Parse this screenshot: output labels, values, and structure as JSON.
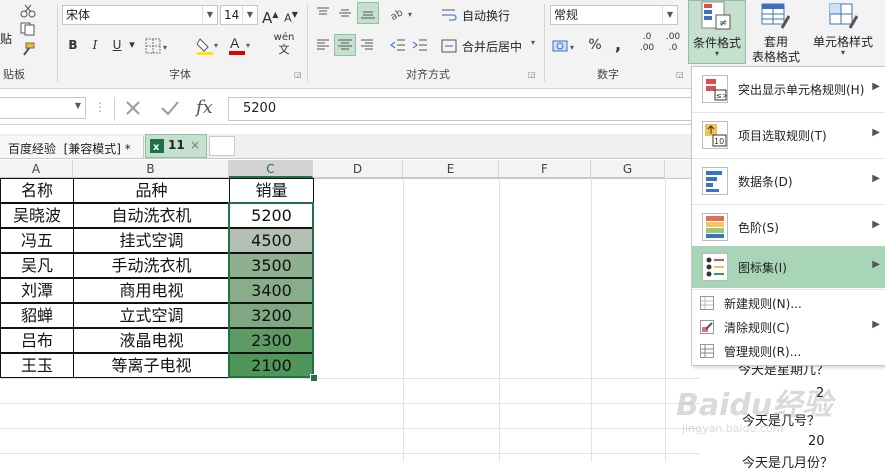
{
  "ribbon": {
    "clipboard": {
      "paste_partial": "贴",
      "label": "贴板"
    },
    "font": {
      "name": "宋体",
      "size": "14",
      "bold": "B",
      "italic": "I",
      "underline": "U",
      "grow": "A",
      "shrink": "A",
      "phonetic": "wén",
      "label": "字体",
      "font_color": "#e00000",
      "fill_color": "#ffe600"
    },
    "alignment": {
      "wrap_text": "自动换行",
      "merge_center": "合并后居中",
      "label": "对齐方式"
    },
    "number": {
      "format": "常规",
      "percent": "%",
      "comma": ",",
      "dec_inc": ".00",
      "dec_dec": ".0",
      "label": "数字"
    },
    "styles": {
      "conditional_format": "条件格式",
      "format_table_1": "套用",
      "format_table_2": "表格格式",
      "cell_styles": "单元格样式"
    }
  },
  "formula_bar": {
    "fx": "fx",
    "value": "5200"
  },
  "tabs": [
    {
      "label": "百度经验  [兼容模式] *"
    },
    {
      "label": "11"
    }
  ],
  "grid": {
    "columns": [
      "A",
      "B",
      "C",
      "D",
      "E",
      "F",
      "G"
    ],
    "headers": [
      "名称",
      "品种",
      "销量"
    ],
    "rows": [
      {
        "name": "吴晓波",
        "type": "自动洗衣机",
        "sales": "5200",
        "fill": "#ffffff"
      },
      {
        "name": "冯五",
        "type": "挂式空调",
        "sales": "4500",
        "fill": "#b4c0b4"
      },
      {
        "name": "吴凡",
        "type": "手动洗衣机",
        "sales": "3500",
        "fill": "#8fb090"
      },
      {
        "name": "刘潭",
        "type": "商用电视",
        "sales": "3400",
        "fill": "#88ad89"
      },
      {
        "name": "貂蝉",
        "type": "立式空调",
        "sales": "3200",
        "fill": "#7fa882"
      },
      {
        "name": "吕布",
        "type": "液晶电视",
        "sales": "2300",
        "fill": "#5d9a64"
      },
      {
        "name": "王玉",
        "type": "等离子电视",
        "sales": "2100",
        "fill": "#50955a"
      }
    ]
  },
  "menu": {
    "items": [
      {
        "label": "突出显示单元格规则(H)"
      },
      {
        "label": "项目选取规则(T)"
      },
      {
        "label": "数据条(D)"
      },
      {
        "label": "色阶(S)"
      },
      {
        "label": "图标集(I)"
      }
    ],
    "sub_items": [
      {
        "label": "新建规则(N)..."
      },
      {
        "label": "清除规则(C)"
      },
      {
        "label": "管理规则(R)..."
      }
    ],
    "highlight_color": "#a8d5b8"
  },
  "behind_text": {
    "q1": "今天是星期几？",
    "a1": "2",
    "q2": "今天是几号？",
    "a2": "20",
    "q3": "今天是几月份？"
  },
  "watermark": "Baidu经验",
  "watermark_sub": "jingyan.baidu.com"
}
